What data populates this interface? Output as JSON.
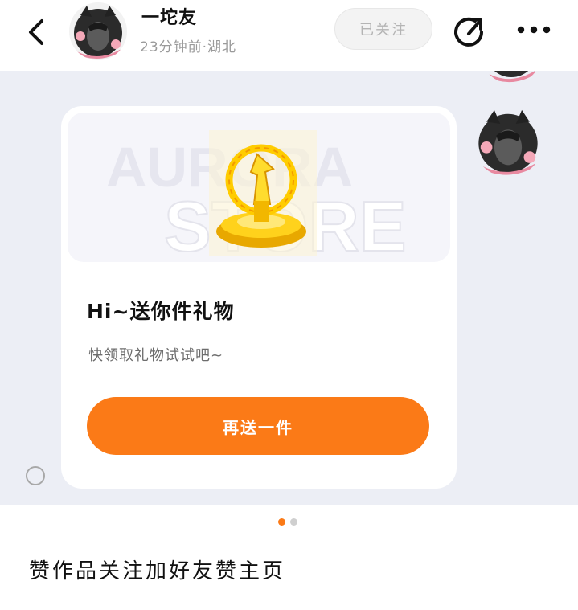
{
  "header": {
    "username": "一坨友",
    "meta": "23分钟前·湖北",
    "follow_label": "已关注"
  },
  "icons": {
    "back": "chevron-left-icon",
    "share": "share-arrow-icon",
    "more": "more-horizontal-icon"
  },
  "gift_card": {
    "banner_text_top": "AURORA",
    "banner_text_bottom": "STORE",
    "title": "Hi~送你件礼物",
    "subtitle": "快领取礼物试试吧~",
    "button_label": "再送一件"
  },
  "pager": {
    "count": 2,
    "active_index": 0
  },
  "post": {
    "text": "赞作品关注加好友赞主页"
  },
  "colors": {
    "accent": "#fb7a17",
    "chat_bg": "#eceef5",
    "gold": "#f4c300"
  }
}
